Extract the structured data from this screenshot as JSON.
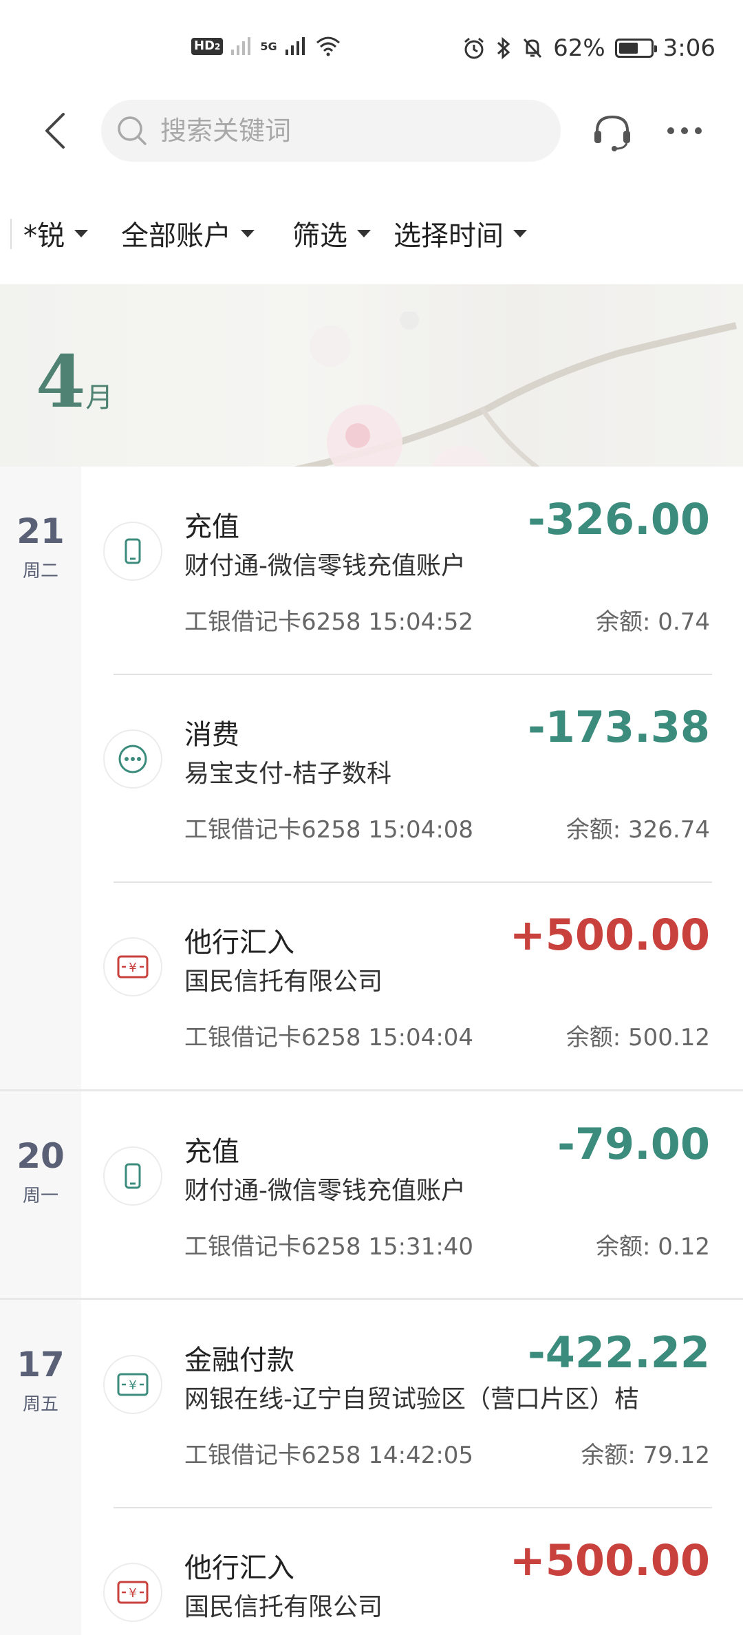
{
  "status_bar": {
    "left_badge": "HD",
    "left_badge_sub": "2",
    "network": "5G",
    "battery_percent": "62%",
    "time": "3:06"
  },
  "header": {
    "search_placeholder": "搜索关键词"
  },
  "filters": {
    "name": "*锐",
    "account": "全部账户",
    "filter": "筛选",
    "time": "选择时间"
  },
  "month_banner": {
    "month_number": "4",
    "month_unit": "月"
  },
  "days": [
    {
      "day": "21",
      "weekday": "周二",
      "transactions": [
        {
          "type": "充值",
          "merchant": "财付通-微信零钱充值账户",
          "card": "工银借记卡6258  15:04:52",
          "amount": "-326.00",
          "balance": "余额: 0.74",
          "icon": "phone-icon"
        },
        {
          "type": "消费",
          "merchant": "易宝支付-桔子数科",
          "card": "工银借记卡6258  15:04:08",
          "amount": "-173.38",
          "balance": "余额: 326.74",
          "icon": "more-dots-icon"
        },
        {
          "type": "他行汇入",
          "merchant": "国民信托有限公司",
          "card": "工银借记卡6258  15:04:04",
          "amount": "+500.00",
          "balance": "余额: 500.12",
          "icon": "yuan-transfer-icon"
        }
      ]
    },
    {
      "day": "20",
      "weekday": "周一",
      "transactions": [
        {
          "type": "充值",
          "merchant": "财付通-微信零钱充值账户",
          "card": "工银借记卡6258  15:31:40",
          "amount": "-79.00",
          "balance": "余额: 0.12",
          "icon": "phone-icon"
        }
      ]
    },
    {
      "day": "17",
      "weekday": "周五",
      "transactions": [
        {
          "type": "金融付款",
          "merchant": "网银在线-辽宁自贸试验区（营口片区）桔",
          "card": "工银借记卡6258  14:42:05",
          "amount": "-422.22",
          "balance": "余额: 79.12",
          "icon": "yuan-payment-icon"
        },
        {
          "type": "他行汇入",
          "merchant": "国民信托有限公司",
          "card": "",
          "amount": "+500.00",
          "balance": "",
          "icon": "yuan-transfer-icon"
        }
      ]
    }
  ],
  "colors": {
    "negative": "#3c8c7d",
    "positive": "#c9413c",
    "month": "#4f8272"
  }
}
